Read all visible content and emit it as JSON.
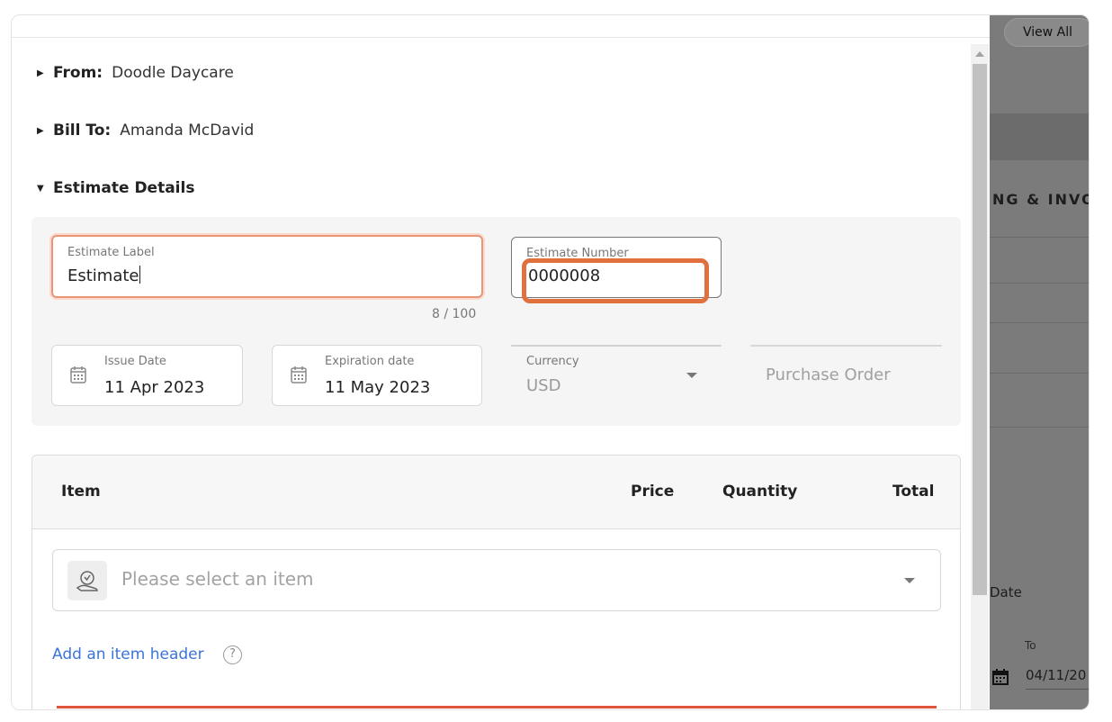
{
  "background": {
    "view_all": "View All",
    "section_heading": "NG & INVO",
    "date_label": "Date",
    "to_label": "To",
    "to_value": "04/11/20"
  },
  "sections": {
    "from": {
      "label": "From:",
      "value": "Doodle Daycare"
    },
    "bill_to": {
      "label": "Bill To:",
      "value": "Amanda McDavid"
    },
    "estimate_details": {
      "label": "Estimate Details"
    }
  },
  "fields": {
    "estimate_label": {
      "label": "Estimate Label",
      "value": "Estimate",
      "counter": "8 / 100"
    },
    "estimate_number": {
      "label": "Estimate Number",
      "value": "0000008"
    },
    "issue_date": {
      "label": "Issue Date",
      "value": "11 Apr 2023"
    },
    "expiration_date": {
      "label": "Expiration date",
      "value": "11 May 2023"
    },
    "currency": {
      "label": "Currency",
      "value": "USD"
    },
    "purchase_order": {
      "placeholder": "Purchase Order"
    }
  },
  "items_table": {
    "headers": {
      "item": "Item",
      "price": "Price",
      "quantity": "Quantity",
      "total": "Total"
    },
    "select_placeholder": "Please select an item",
    "add_header_link": "Add an item header",
    "help": "?"
  },
  "colors": {
    "highlight": "#e0703e",
    "focus_border": "#e8957a",
    "link": "#3b74d9",
    "error_line": "#e0533c"
  }
}
